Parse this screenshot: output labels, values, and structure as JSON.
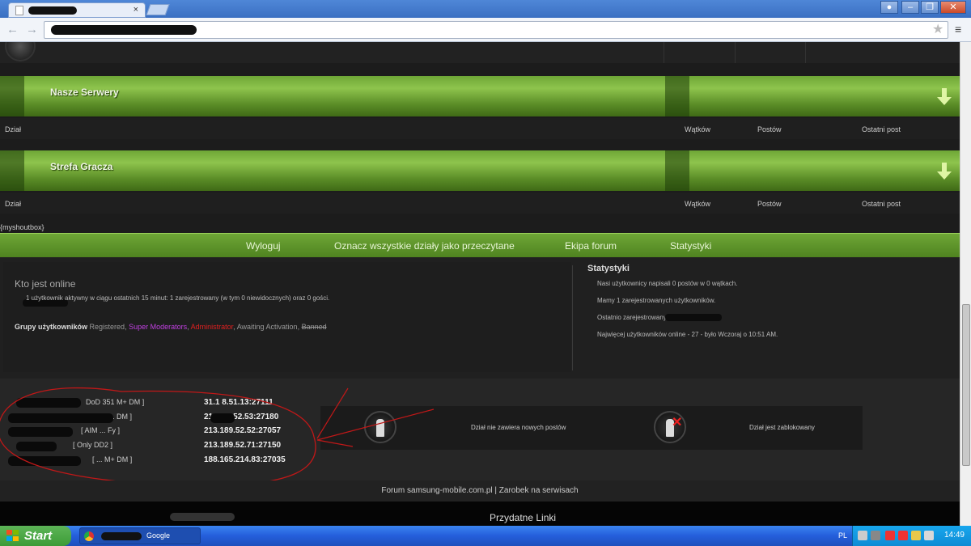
{
  "browser": {
    "tab_close": "×",
    "nav_back": "←",
    "nav_forward": "→",
    "menu_icon": "≡",
    "window_buttons": [
      "",
      "–",
      "❐",
      "✕"
    ]
  },
  "categories": [
    {
      "title": "Nasze Serwery",
      "columns": [
        "Dział",
        "Wątków",
        "Postów",
        "Ostatni post"
      ]
    },
    {
      "title": "Strefa Gracza",
      "columns": [
        "Dział",
        "Wątków",
        "Postów",
        "Ostatni post"
      ]
    }
  ],
  "shoutbox": "{myshoutbox}",
  "navbar": {
    "logout": "Wyloguj",
    "mark_read": "Oznacz wszystkie działy jako przeczytane",
    "team": "Ekipa forum",
    "stats": "Statystyki"
  },
  "who_online": {
    "title": "Kto jest online",
    "line": "1 użytkownik aktywny w ciągu ostatnich 15 minut: 1 zarejestrowany (w tym 0 niewidocznych) oraz 0 gości.",
    "groups_label": "Grupy użytkowników",
    "groups": [
      {
        "name": "Registered",
        "color": "#999999"
      },
      {
        "name": "Super Moderators",
        "color": "#c040e0"
      },
      {
        "name": "Administrator",
        "color": "#e02020"
      },
      {
        "name": "Awaiting Activation",
        "color": "#999999"
      },
      {
        "name": "Banned",
        "color": "#999999"
      }
    ]
  },
  "statistics": {
    "title": "Statystyki",
    "lines": [
      "Nasi użytkownicy napisali 0 postów w 0 wątkach.",
      "Mamy 1 zarejestrowanych użytkowników.",
      "Ostatnio zarejestrowany:",
      "Najwięcej użytkowników online - 27 - było Wczoraj o 10:51 AM."
    ]
  },
  "servers": [
    {
      "name": "DoD 351 M+ DM ]",
      "addr": "31.1 8.51.13:27111"
    },
    {
      "name": "DoD 1 ... DM ]",
      "addr": "213.15 .52.53:27180"
    },
    {
      "name": "[ AIM ... Fy ]",
      "addr": "213.189.52.52:27057"
    },
    {
      "name": "[ Only DD2 ]",
      "addr": "213.189.52.71:27150"
    },
    {
      "name": "[ ... M+ DM ]",
      "addr": "188.165.214.83:27035"
    }
  ],
  "legend": {
    "no_new": "Dział nie zawiera nowych postów",
    "locked": "Dział jest zablokowany"
  },
  "footer": {
    "text": "Forum samsung-mobile.com.pl | Zarobek na serwisach",
    "links_title": "Przydatne Linki"
  },
  "taskbar": {
    "start": "Start",
    "item": "Google",
    "lang": "PL",
    "clock": "14:49"
  },
  "colors": {
    "accent_green": "#6ea636",
    "taskbar_blue": "#245edb"
  }
}
